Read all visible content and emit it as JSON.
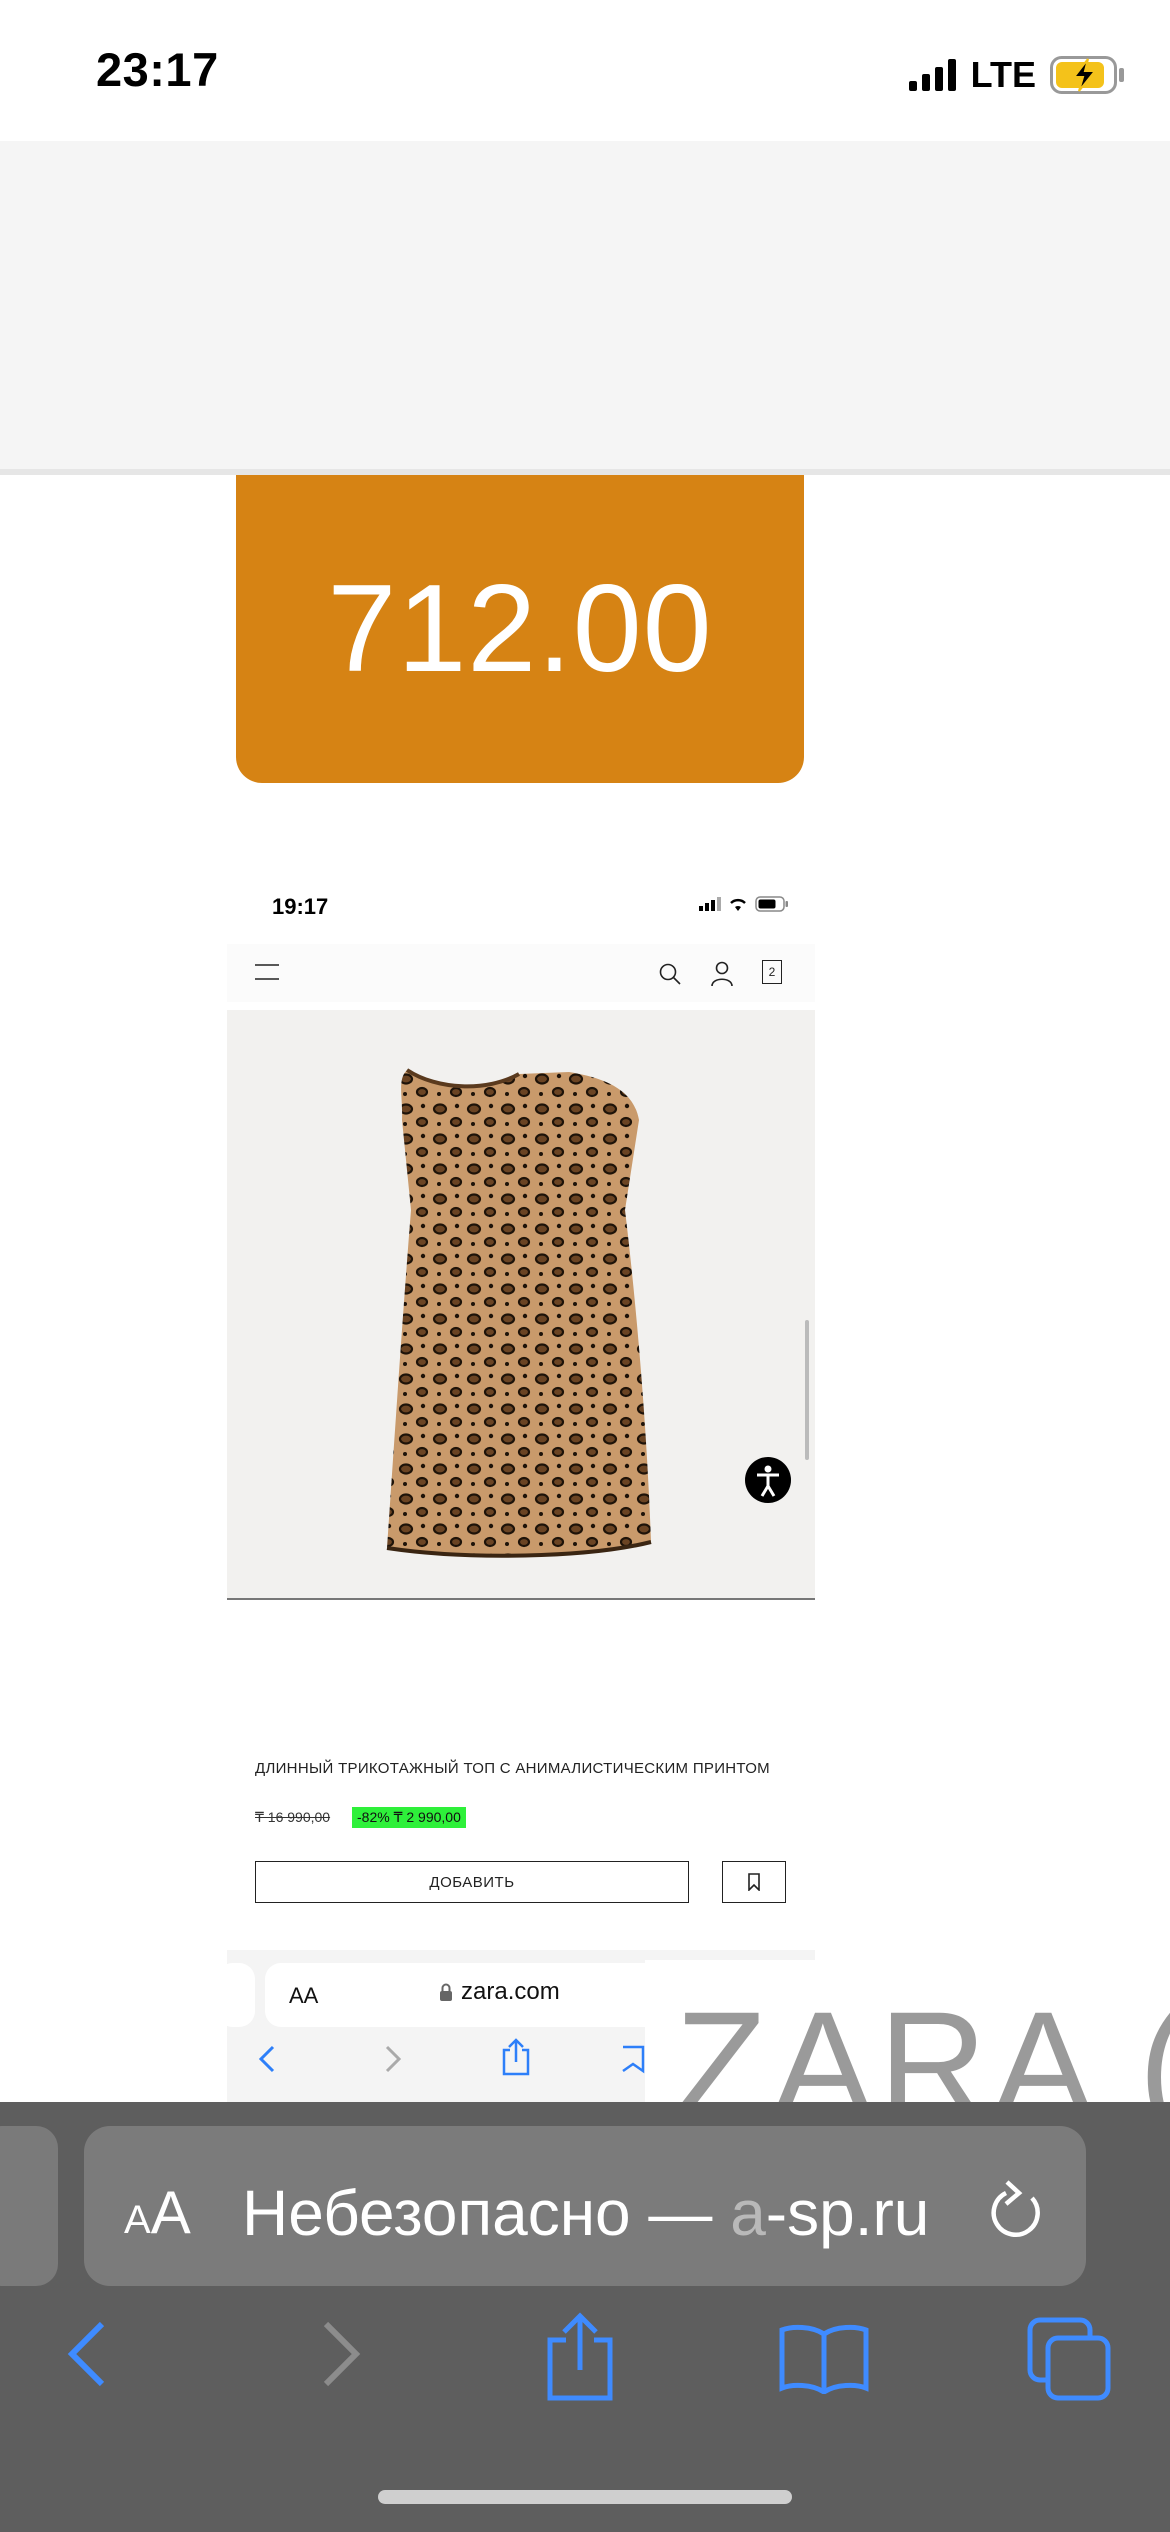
{
  "status_bar": {
    "time": "23:17",
    "network": "LTE"
  },
  "price_banner": {
    "value": "712.00",
    "color": "#d68314"
  },
  "embedded_screenshot": {
    "status_time": "19:17",
    "cart_count": "2",
    "product_title": "ДЛИННЫЙ ТРИКОТАЖНЫЙ ТОП С АНИМАЛИСТИЧЕСКИМ ПРИНТОМ",
    "old_price": "₸ 16 990,00",
    "sale": "-82%   ₸ 2 990,00",
    "sale_color": "#2ef03a",
    "add_button": "ДОБАВИТЬ",
    "url_aa": "AA",
    "url_host": "zara.com"
  },
  "overlay_text": "ZARA (K",
  "browser": {
    "aa_small": "A",
    "aa_big": "A",
    "address_text": "Небезопасно — ",
    "address_host_dim": "а",
    "address_host": "-sp.ru"
  },
  "icons": [
    "signal-icon",
    "battery-charging-icon",
    "menu-icon",
    "search-icon",
    "user-icon",
    "bag-icon",
    "accessibility-icon",
    "bookmark-icon",
    "lock-icon",
    "back-icon",
    "forward-icon",
    "share-icon",
    "bookmarks-icon",
    "tabs-icon",
    "reload-icon"
  ]
}
